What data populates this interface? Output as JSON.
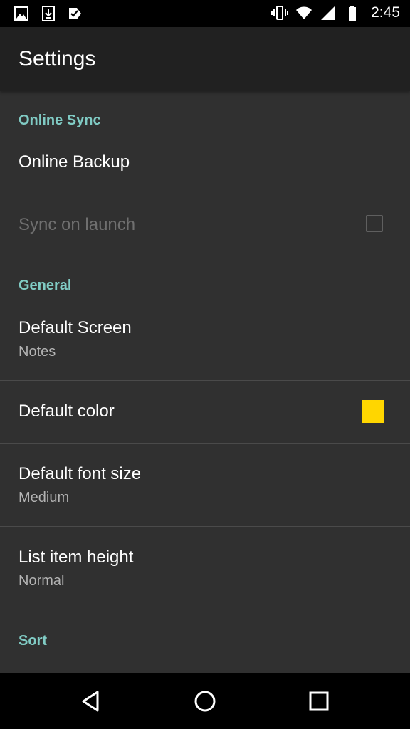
{
  "status_bar": {
    "time": "2:45",
    "left_icons": [
      "image-icon",
      "download-icon",
      "task-icon"
    ],
    "right_icons": [
      "vibrate-icon",
      "wifi-icon",
      "signal-icon",
      "battery-icon"
    ]
  },
  "app_bar": {
    "title": "Settings"
  },
  "sections": {
    "online_sync": {
      "header": "Online Sync",
      "online_backup": {
        "title": "Online Backup"
      },
      "sync_on_launch": {
        "title": "Sync on launch",
        "checked": false,
        "enabled": false
      }
    },
    "general": {
      "header": "General",
      "default_screen": {
        "title": "Default Screen",
        "summary": "Notes"
      },
      "default_color": {
        "title": "Default color",
        "color": "#FFD600"
      },
      "default_font_size": {
        "title": "Default font size",
        "summary": "Medium"
      },
      "list_item_height": {
        "title": "List item height",
        "summary": "Normal"
      }
    },
    "sort": {
      "header": "Sort"
    }
  },
  "nav_bar": {
    "icons": [
      "back-icon",
      "home-icon",
      "recents-icon"
    ]
  },
  "colors": {
    "background": "#303030",
    "app_bar": "#212121",
    "category_accent": "#80CBC4",
    "status_bar": "#000000"
  }
}
